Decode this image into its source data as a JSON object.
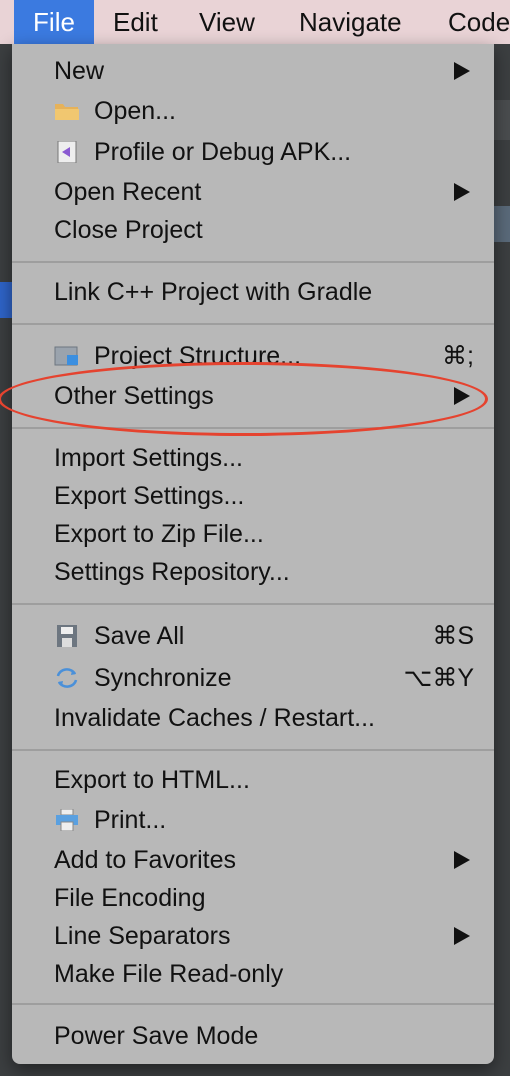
{
  "menubar": {
    "file": "File",
    "edit": "Edit",
    "view": "View",
    "navigate": "Navigate",
    "code": "Code"
  },
  "file_menu": {
    "new": "New",
    "open": "Open...",
    "profile_debug": "Profile or Debug APK...",
    "open_recent": "Open Recent",
    "close_project": "Close Project",
    "link_cpp": "Link C++ Project with Gradle",
    "project_structure": "Project Structure...",
    "project_structure_shortcut": "⌘;",
    "other_settings": "Other Settings",
    "import_settings": "Import Settings...",
    "export_settings": "Export Settings...",
    "export_zip": "Export to Zip File...",
    "settings_repo": "Settings Repository...",
    "save_all": "Save All",
    "save_all_shortcut": "⌘S",
    "synchronize": "Synchronize",
    "synchronize_shortcut": "⌥⌘Y",
    "invalidate": "Invalidate Caches / Restart...",
    "export_html": "Export to HTML...",
    "print": "Print...",
    "add_favorites": "Add to Favorites",
    "file_encoding": "File Encoding",
    "line_separators": "Line Separators",
    "read_only": "Make File Read-only",
    "power_save": "Power Save Mode"
  },
  "icons": {
    "open": "folder-icon",
    "profile": "apk-icon",
    "project_structure": "project-structure-icon",
    "save_all": "save-icon",
    "synchronize": "sync-icon",
    "print": "printer-icon"
  },
  "colors": {
    "menubar_bg": "#e9d3d6",
    "selected_menu": "#3b7ae0",
    "menu_bg": "#b8b8b8",
    "highlight_ellipse": "#e5432f"
  }
}
